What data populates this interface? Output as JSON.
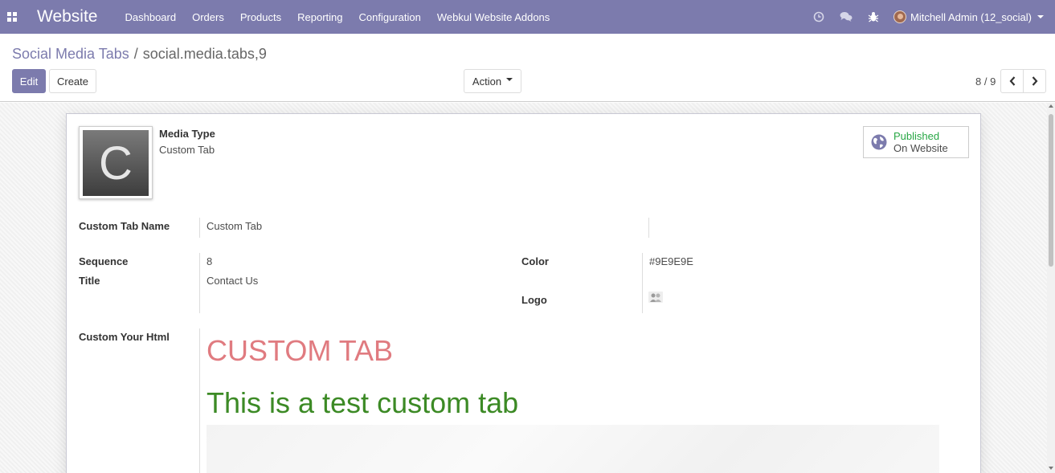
{
  "navbar": {
    "app_title": "Website",
    "menu": [
      "Dashboard",
      "Orders",
      "Products",
      "Reporting",
      "Configuration",
      "Webkul Website Addons"
    ],
    "user": "Mitchell Admin (12_social)",
    "bg_color": "#7c7bad"
  },
  "breadcrumb": {
    "parent": "Social Media Tabs",
    "separator": "/",
    "current": "social.media.tabs,9"
  },
  "buttons": {
    "edit": "Edit",
    "create": "Create",
    "action": "Action"
  },
  "pager": {
    "value": "8 / 9"
  },
  "record": {
    "logo_letter": "C",
    "media_type_label": "Media Type",
    "media_type_value": "Custom Tab",
    "published_status": "Published",
    "published_sub": "On Website",
    "custom_tab_name_label": "Custom Tab Name",
    "custom_tab_name_value": "Custom Tab",
    "sequence_label": "Sequence",
    "sequence_value": "8",
    "title_label": "Title",
    "title_value": "Contact Us",
    "color_label": "Color",
    "color_value": "#9E9E9E",
    "logo_label": "Logo",
    "custom_html_label": "Custom Your Html",
    "html_heading": "CUSTOM TAB",
    "html_subheading": "This is a test custom tab"
  }
}
